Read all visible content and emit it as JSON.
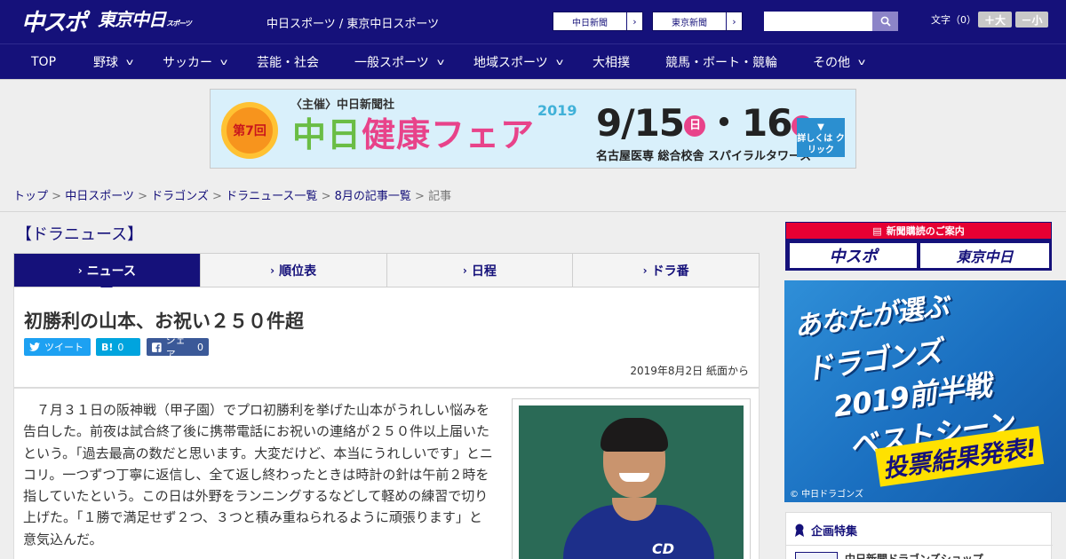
{
  "header": {
    "logo_main": "中スポ",
    "logo_sub": "東京中日",
    "logo_sub_small": "スポーツ",
    "site_names": "中日スポーツ / 東京中日スポーツ",
    "paper_buttons": [
      "中日新聞",
      "東京新聞"
    ],
    "search": {
      "placeholder": ""
    },
    "font_size_label": "文字（0）",
    "font_increase": "＋大",
    "font_decrease": "－小",
    "brand_color": "#15117a"
  },
  "nav": {
    "items": [
      {
        "label": "TOP",
        "dropdown": false
      },
      {
        "label": "野球",
        "dropdown": true
      },
      {
        "label": "サッカー",
        "dropdown": true
      },
      {
        "label": "芸能・社会",
        "dropdown": false
      },
      {
        "label": "一般スポーツ",
        "dropdown": true
      },
      {
        "label": "地域スポーツ",
        "dropdown": true
      },
      {
        "label": "大相撲",
        "dropdown": false
      },
      {
        "label": "競馬・ボート・競輪",
        "dropdown": false
      },
      {
        "label": "その他",
        "dropdown": true
      }
    ]
  },
  "banner": {
    "badge": "第7回",
    "host": "〈主催〉中日新聞社",
    "title_green": "中日",
    "title_pink": "健康",
    "title_green2": "フェア",
    "year": "2019",
    "dates_a": "9/15",
    "day_a": "日",
    "dates_sep": "・",
    "dates_b": "16",
    "day_b": "祝",
    "venue": "名古屋医専 総合校舎 スパイラルタワーズ",
    "detail": "詳しくは クリック"
  },
  "breadcrumb": {
    "links": [
      "トップ",
      "中日スポーツ",
      "ドラゴンズ",
      "ドラニュース一覧",
      "8月の記事一覧"
    ],
    "separator": ">",
    "current": "記事"
  },
  "main": {
    "section_title": "【ドラニュース】",
    "tabs": [
      {
        "label": "ニュース",
        "active": true
      },
      {
        "label": "順位表",
        "active": false
      },
      {
        "label": "日程",
        "active": false
      },
      {
        "label": "ドラ番",
        "active": false
      }
    ],
    "headline": "初勝利の山本、お祝い２５０件超",
    "share": {
      "tweet": "ツイート",
      "hatena_label": "B!",
      "hatena_count": "0",
      "fb_label": "シェア",
      "fb_count": "0"
    },
    "pubdate": "2019年8月2日 紙面から",
    "body": "７月３１日の阪神戦（甲子園）でプロ初勝利を挙げた山本がうれしい悩みを告白した。前夜は試合終了後に携帯電話にお祝いの連絡が２５０件以上届いたという。「過去最高の数だと思います。大変だけど、本当にうれしいです」とニコリ。一つずつ丁寧に返信し、全て返し終わったときは時計の針は午前２時を指していたという。この日は外野をランニングするなどして軽めの練習で切り上げた。「１勝で満足せず２つ、３つと積み重ねられるように頑張ります」と意気込んだ。"
  },
  "sidebar": {
    "subscribe_header": "新聞購読のご案内",
    "subscribe_buttons": [
      "中スポ",
      "東京中日"
    ],
    "ad_lines": [
      "あなたが選ぶ",
      "ドラゴンズ",
      "2019前半戦",
      "ベストシーン"
    ],
    "ad_result": "投票結果発表!",
    "ad_copyright": "© 中日ドラゴンズ",
    "feature_title": "企画特集",
    "feature_item": "中日新聞ドラゴンズショップ"
  }
}
